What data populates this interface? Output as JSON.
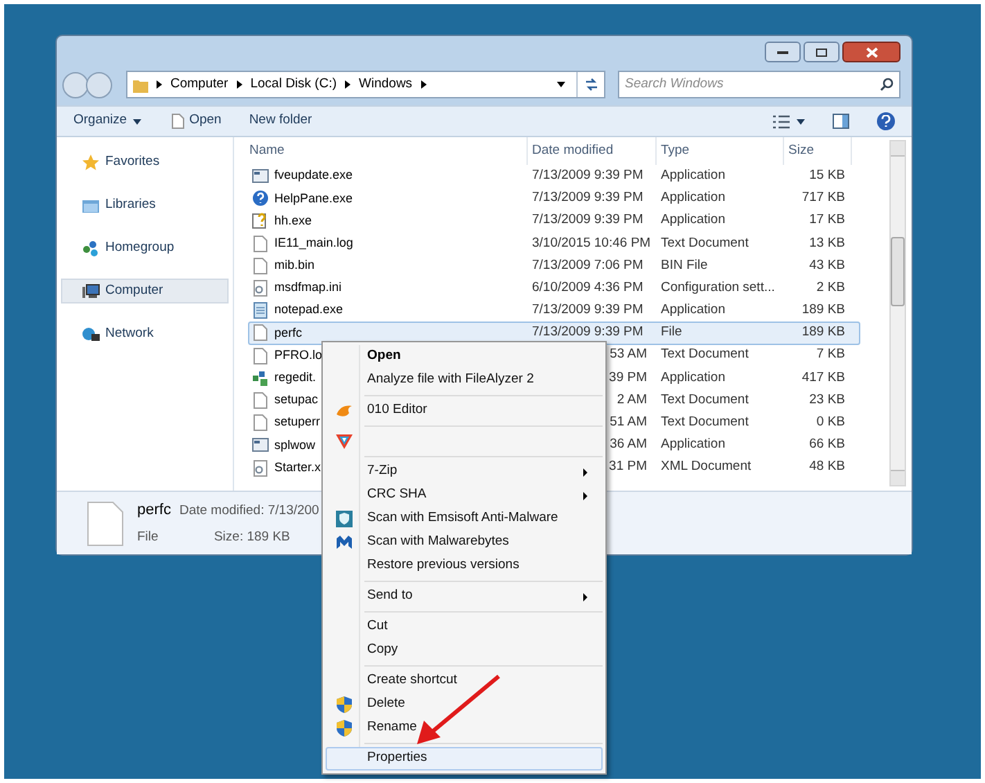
{
  "address": {
    "crumbs": [
      "Computer",
      "Local Disk (C:)",
      "Windows"
    ]
  },
  "search": {
    "placeholder": "Search Windows"
  },
  "toolbar": {
    "organize": "Organize",
    "open": "Open",
    "new_folder": "New folder"
  },
  "sidebar": {
    "items": [
      {
        "label": "Favorites",
        "kind": "star",
        "selected": false
      },
      {
        "label": "Libraries",
        "kind": "library",
        "selected": false
      },
      {
        "label": "Homegroup",
        "kind": "homegroup",
        "selected": false
      },
      {
        "label": "Computer",
        "kind": "computer",
        "selected": true
      },
      {
        "label": "Network",
        "kind": "network",
        "selected": false
      }
    ]
  },
  "table": {
    "columns": [
      "Name",
      "Date modified",
      "Type",
      "Size"
    ],
    "rows": [
      {
        "kind": "app",
        "name": "fveupdate.exe",
        "date": "7/13/2009 9:39 PM",
        "type": "Application",
        "size": "15 KB",
        "selected": false,
        "covered": false
      },
      {
        "kind": "help",
        "name": "HelpPane.exe",
        "date": "7/13/2009 9:39 PM",
        "type": "Application",
        "size": "717 KB",
        "selected": false,
        "covered": false
      },
      {
        "kind": "helpdoc",
        "name": "hh.exe",
        "date": "7/13/2009 9:39 PM",
        "type": "Application",
        "size": "17 KB",
        "selected": false,
        "covered": false
      },
      {
        "kind": "doc",
        "name": "IE11_main.log",
        "date": "3/10/2015 10:46 PM",
        "type": "Text Document",
        "size": "13 KB",
        "selected": false,
        "covered": false
      },
      {
        "kind": "doc",
        "name": "mib.bin",
        "date": "7/13/2009 7:06 PM",
        "type": "BIN File",
        "size": "43 KB",
        "selected": false,
        "covered": false
      },
      {
        "kind": "config",
        "name": "msdfmap.ini",
        "date": "6/10/2009 4:36 PM",
        "type": "Configuration sett...",
        "size": "2 KB",
        "selected": false,
        "covered": false
      },
      {
        "kind": "notepad",
        "name": "notepad.exe",
        "date": "7/13/2009 9:39 PM",
        "type": "Application",
        "size": "189 KB",
        "selected": false,
        "covered": false
      },
      {
        "kind": "doc",
        "name": "perfc",
        "date": "7/13/2009 9:39 PM",
        "type": "File",
        "size": "189 KB",
        "selected": true,
        "covered": false
      },
      {
        "kind": "doc",
        "name": "PFRO.lo",
        "date": "53 AM",
        "type": "Text Document",
        "size": "7 KB",
        "selected": false,
        "covered": true
      },
      {
        "kind": "registry",
        "name": "regedit.",
        "date": "39 PM",
        "type": "Application",
        "size": "417 KB",
        "selected": false,
        "covered": true
      },
      {
        "kind": "doc",
        "name": "setupac",
        "date": "2 AM",
        "type": "Text Document",
        "size": "23 KB",
        "selected": false,
        "covered": true
      },
      {
        "kind": "doc",
        "name": "setuperr",
        "date": "51 AM",
        "type": "Text Document",
        "size": "0 KB",
        "selected": false,
        "covered": true
      },
      {
        "kind": "app",
        "name": "splwow",
        "date": "36 AM",
        "type": "Application",
        "size": "66 KB",
        "selected": false,
        "covered": true
      },
      {
        "kind": "config",
        "name": "Starter.x",
        "date": "31 PM",
        "type": "XML Document",
        "size": "48 KB",
        "selected": false,
        "covered": true
      }
    ]
  },
  "details": {
    "name": "perfc",
    "date_modified": "Date modified: 7/13/200",
    "type": "File",
    "size": "Size: 189 KB"
  },
  "context_menu": {
    "items": [
      {
        "kind": "plain",
        "label": "Open",
        "bold": true,
        "submenu": false,
        "selected": false
      },
      {
        "kind": "plain",
        "label": "Analyze file with FileAlyzer 2",
        "bold": false,
        "submenu": false,
        "selected": false
      },
      {
        "kind": "separator"
      },
      {
        "kind": "editor",
        "label": "010 Editor",
        "bold": false,
        "submenu": false,
        "selected": false
      },
      {
        "kind": "separator"
      },
      {
        "kind": "vendor",
        "selected": false
      },
      {
        "kind": "separator"
      },
      {
        "kind": "plain",
        "label": "7-Zip",
        "bold": false,
        "submenu": true,
        "selected": false
      },
      {
        "kind": "plain",
        "label": "CRC SHA",
        "bold": false,
        "submenu": true,
        "selected": false
      },
      {
        "kind": "emsisoft",
        "label": "Scan with Emsisoft Anti-Malware",
        "bold": false,
        "submenu": false,
        "selected": false
      },
      {
        "kind": "malwarebytes",
        "label": "Scan with Malwarebytes",
        "bold": false,
        "submenu": false,
        "selected": false
      },
      {
        "kind": "plain",
        "label": "Restore previous versions",
        "bold": false,
        "submenu": false,
        "selected": false
      },
      {
        "kind": "separator"
      },
      {
        "kind": "plain",
        "label": "Send to",
        "bold": false,
        "submenu": true,
        "selected": false
      },
      {
        "kind": "separator"
      },
      {
        "kind": "plain",
        "label": "Cut",
        "bold": false,
        "submenu": false,
        "selected": false
      },
      {
        "kind": "plain",
        "label": "Copy",
        "bold": false,
        "submenu": false,
        "selected": false
      },
      {
        "kind": "separator"
      },
      {
        "kind": "plain",
        "label": "Create shortcut",
        "bold": false,
        "submenu": false,
        "selected": false
      },
      {
        "kind": "shield",
        "label": "Delete",
        "bold": false,
        "submenu": false,
        "selected": false
      },
      {
        "kind": "shield",
        "label": "Rename",
        "bold": false,
        "submenu": false,
        "selected": false
      },
      {
        "kind": "separator"
      },
      {
        "kind": "plain",
        "label": "Properties",
        "bold": false,
        "submenu": false,
        "selected": true
      }
    ]
  }
}
